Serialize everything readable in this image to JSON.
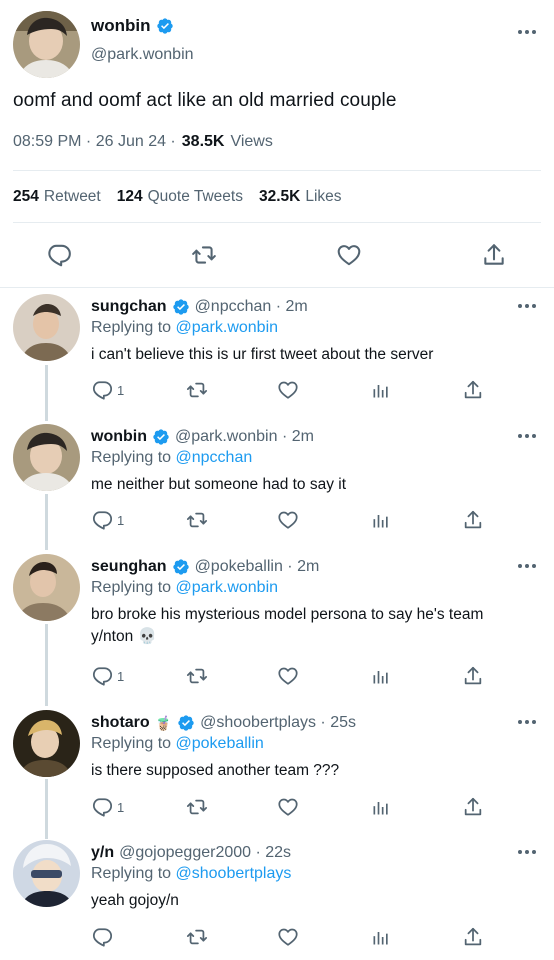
{
  "main": {
    "name": "wonbin",
    "handle": "@park.wonbin",
    "text": "oomf and oomf act like an old married couple",
    "time": "08:59 PM · 26 Jun 24 ·",
    "views_count": "38.5K",
    "views_label": "Views",
    "retweets_count": "254",
    "retweets_label": "Retweet",
    "quotes_count": "124",
    "quotes_label": "Quote Tweets",
    "likes_count": "32.5K",
    "likes_label": "Likes"
  },
  "replies": [
    {
      "name": "sungchan",
      "handle": "@npcchan · 2m",
      "replying": "Replying to",
      "to": "@park.wonbin",
      "text": "i can't believe this is ur first tweet about the server",
      "reply_count": "1",
      "verified": true,
      "emoji": ""
    },
    {
      "name": "wonbin",
      "handle": "@park.wonbin · 2m",
      "replying": "Replying to",
      "to": "@npcchan",
      "text": "me neither but someone had to say it",
      "reply_count": "1",
      "verified": true,
      "emoji": ""
    },
    {
      "name": "seunghan",
      "handle": "@pokeballin · 2m",
      "replying": "Replying to",
      "to": "@park.wonbin",
      "text": "bro broke his mysterious model persona to say he's team y/nton 💀",
      "reply_count": "1",
      "verified": true,
      "emoji": ""
    },
    {
      "name": "shotaro",
      "handle": "@shoobertplays · 25s",
      "replying": "Replying to",
      "to": "@pokeballin",
      "text": "is there supposed another team ???",
      "reply_count": "1",
      "verified": true,
      "emoji": "🧋"
    },
    {
      "name": "y/n",
      "handle": "@gojopegger2000 · 22s",
      "replying": "Replying to",
      "to": "@shoobertplays",
      "text": "yeah gojoy/n",
      "reply_count": "",
      "verified": false,
      "emoji": ""
    }
  ],
  "colors": {
    "accent": "#1d9bf0",
    "muted": "#536471",
    "text": "#0f1419",
    "divider": "#e6ecf0"
  }
}
